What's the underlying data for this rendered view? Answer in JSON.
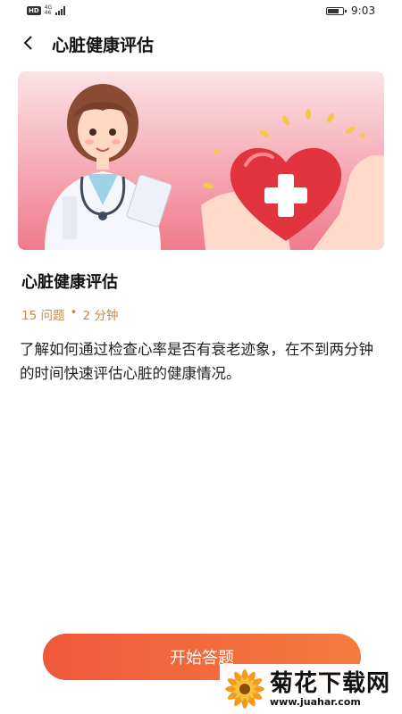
{
  "status_bar": {
    "left_badge": "HD",
    "network_top": "4G",
    "network_bottom": "46",
    "time": "9:03",
    "battery_level": 0.85
  },
  "header": {
    "title": "心脏健康评估",
    "back_icon": "chevron-left-icon"
  },
  "assessment": {
    "title": "心脏健康评估",
    "questions": "15 问题",
    "separator": "•",
    "duration": "2 分钟",
    "description": "了解如何通过检查心率是否有衰老迹象，在不到两分钟的时间快速评估心脏的健康情况。"
  },
  "actions": {
    "start_label": "开始答题"
  },
  "watermark": {
    "name": "菊花下载网",
    "url": "www.juahar.com"
  },
  "colors": {
    "accent": "#f15f3c",
    "meta": "#c58a4a",
    "heart": "#e2343f"
  }
}
